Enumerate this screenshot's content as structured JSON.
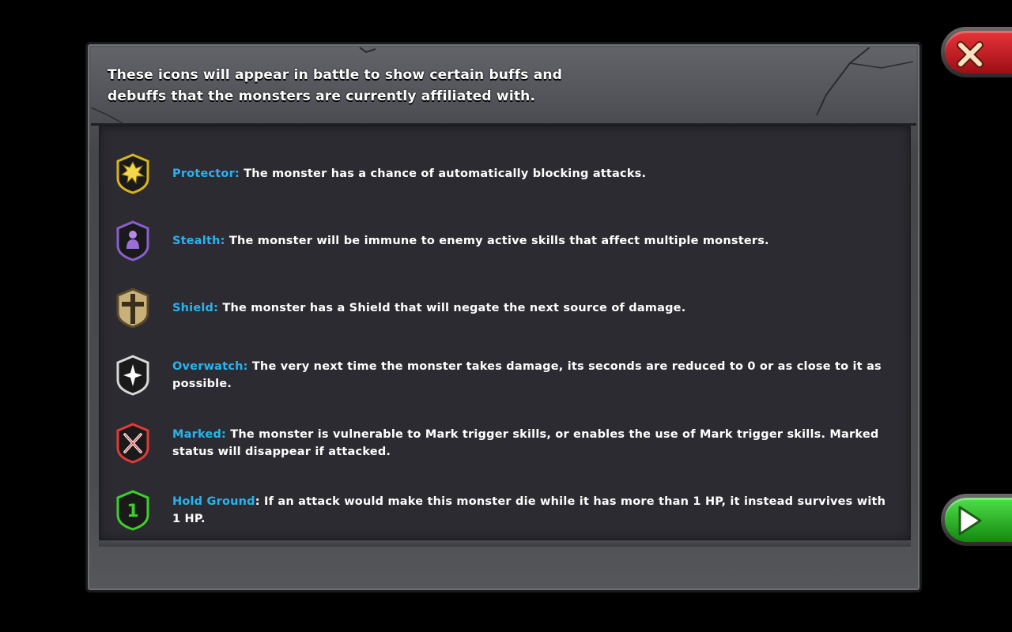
{
  "header": {
    "line1": "These icons will appear in battle to show certain buffs and",
    "line2": "debuffs that the monsters are currently affiliated with."
  },
  "buffs": [
    {
      "name": "Protector:",
      "description": "The monster has a chance of automatically blocking attacks.",
      "icon": "protector-icon",
      "color": "#e4c21c"
    },
    {
      "name": "Stealth:",
      "description": "The monster will be immune to enemy active skills that affect multiple monsters.",
      "icon": "stealth-icon",
      "color": "#8a5fcf"
    },
    {
      "name": "Shield:",
      "description": "The monster has a Shield that will negate the next source of damage.",
      "icon": "shield-cross-icon",
      "color": "#c8b07a"
    },
    {
      "name": "Overwatch:",
      "description": "The very next time the monster takes damage, its seconds are reduced to 0 or as close to it as possible.",
      "icon": "overwatch-icon",
      "color": "#d8d8d8"
    },
    {
      "name": "Marked:",
      "description": "The monster is vulnerable to Mark trigger skills, or enables the use of Mark trigger skills. Marked status will disappear if attacked.",
      "icon": "marked-icon",
      "color": "#e23a3a"
    },
    {
      "name": "Hold Ground",
      "description": ": If an attack would make this monster die while it has more than 1 HP, it instead survives with 1 HP.",
      "icon": "hold-ground-icon",
      "color": "#3fcf2c",
      "badge": "1"
    }
  ],
  "colors": {
    "name_accent": "#27b4f0",
    "close_button": "#d62328",
    "next_button": "#2cb826"
  },
  "close_button_icon": "close-icon",
  "next_button_icon": "play-arrow-icon"
}
